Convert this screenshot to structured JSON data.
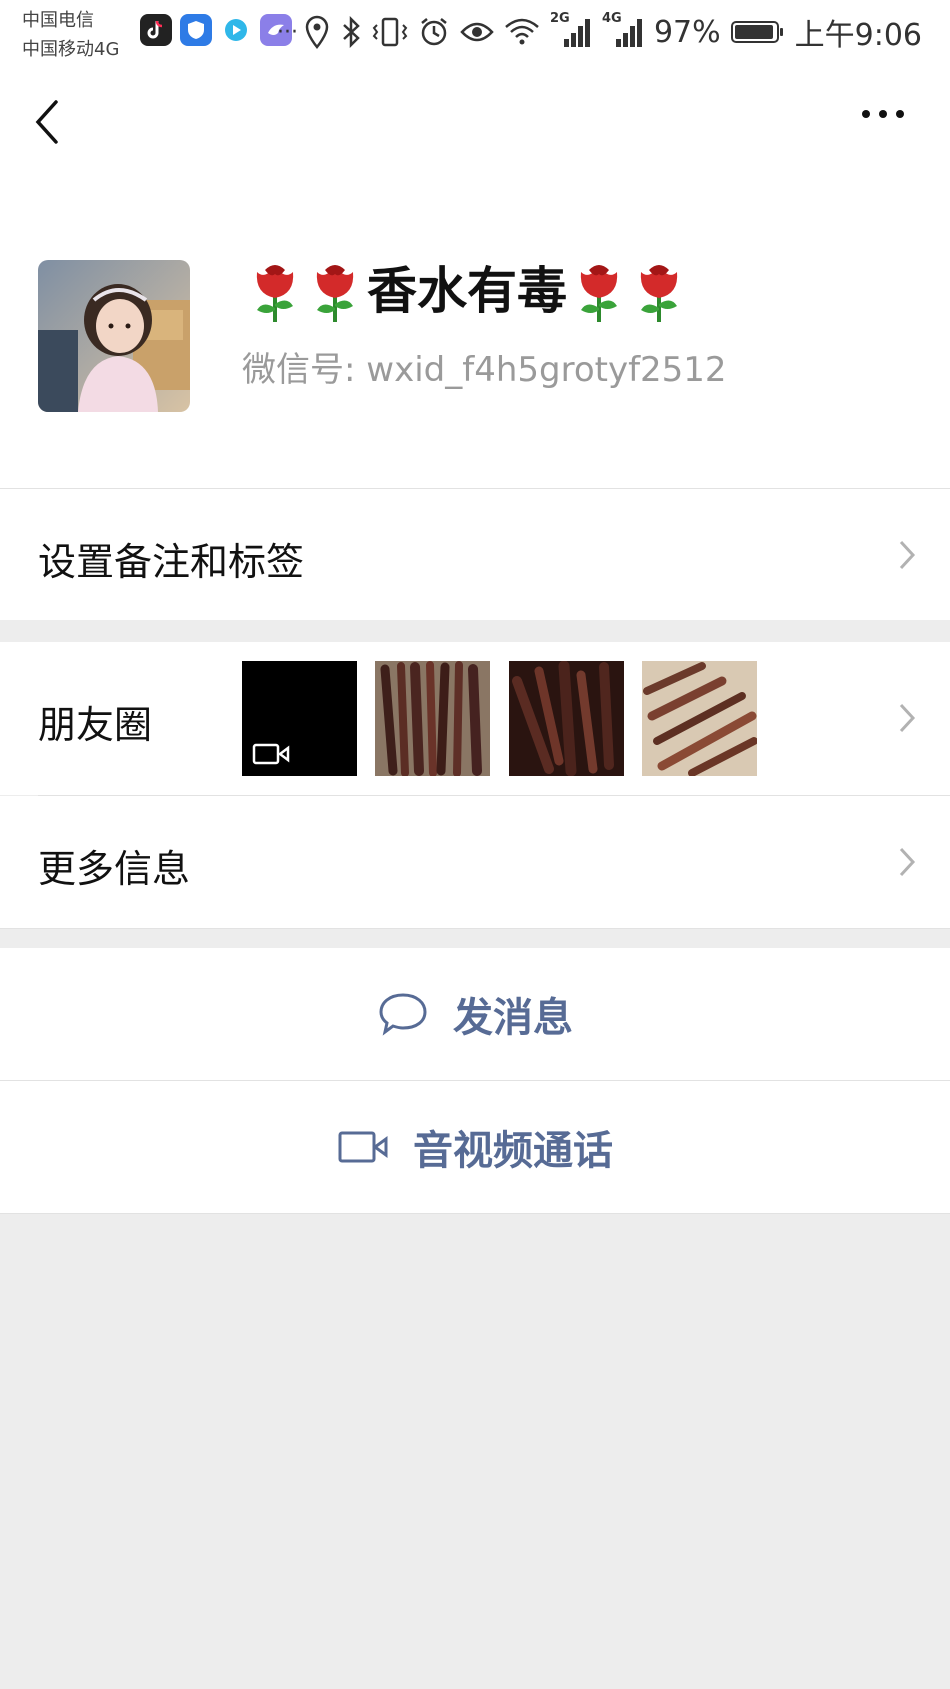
{
  "status_bar": {
    "carrier_1": "中国电信",
    "carrier_2": "中国移动4G",
    "dots": "···",
    "network_2g": "2G",
    "network_4g": "4G",
    "battery": "97%",
    "time": "上午9:06",
    "battery_level": 0.97,
    "apps": [
      "tiktok-icon",
      "shield-app-icon",
      "play-app-icon",
      "bird-app-icon"
    ],
    "icons": [
      "location-icon",
      "bluetooth-icon",
      "vibrate-icon",
      "alarm-icon",
      "eye-icon",
      "wifi-icon",
      "signal-icon",
      "signal-icon"
    ]
  },
  "nav": {
    "back_icon": "chevron-left-icon",
    "more_icon": "more-dots-icon"
  },
  "profile": {
    "name": "香水有毒",
    "name_decoration": "rose-icon",
    "wechat_id": "微信号: wxid_f4h5grotyf2512"
  },
  "rows": {
    "remark": "设置备注和标签",
    "moments": "朋友圈",
    "more_info": "更多信息"
  },
  "moments_thumbnails": [
    "video-thumbnail",
    "dried-meat-photo",
    "dried-meat-photo",
    "dried-meat-photo"
  ],
  "actions": {
    "message": "发消息",
    "call": "音视频通话"
  },
  "colors": {
    "accent": "#576b95",
    "background": "#ededed",
    "card": "#ffffff",
    "divider": "#e2e2e2"
  }
}
